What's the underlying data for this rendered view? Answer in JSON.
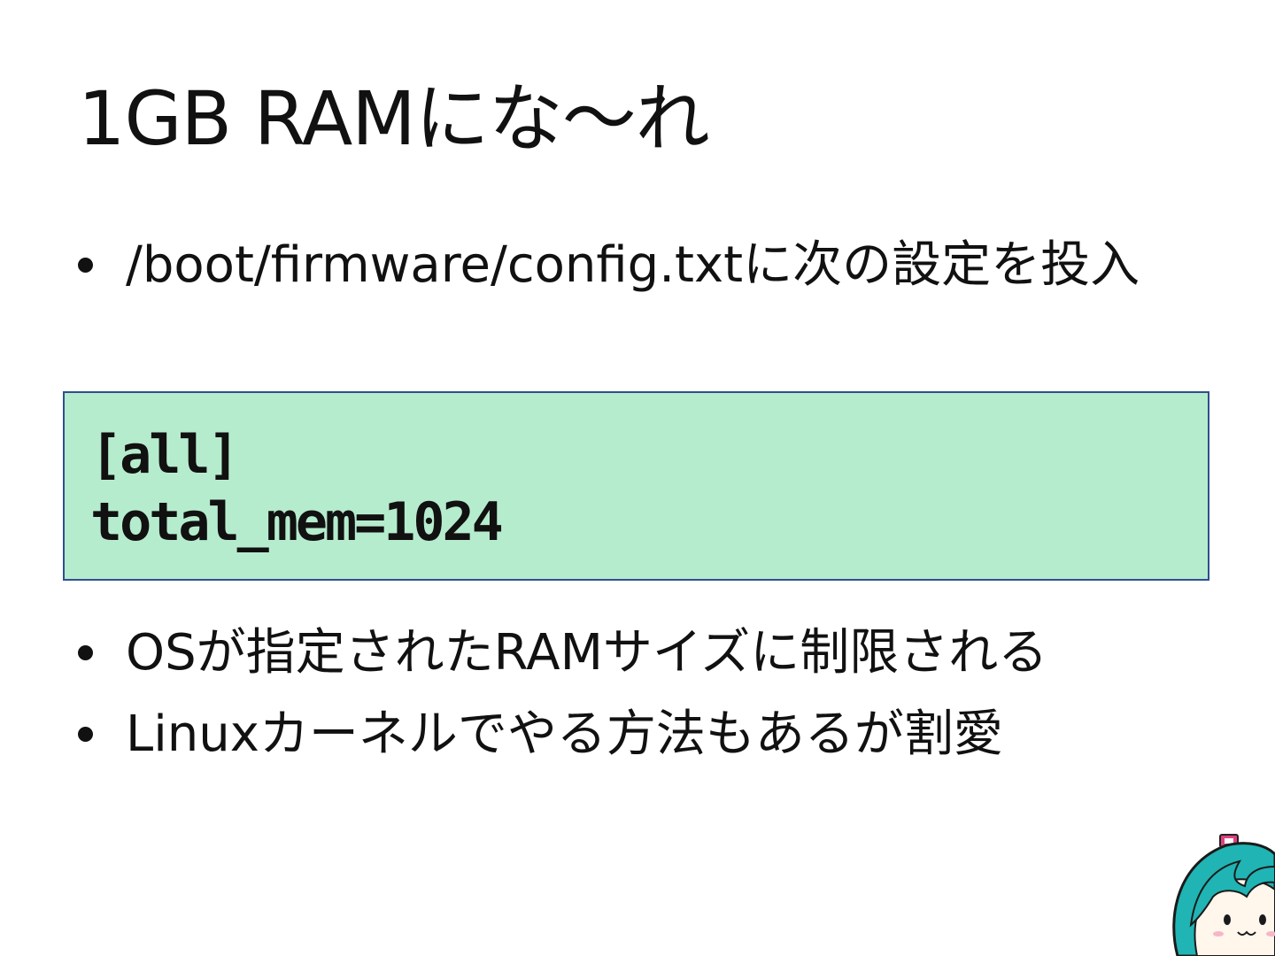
{
  "slide": {
    "title": "1GB RAMにな～れ",
    "bullets_top": [
      "/boot/firmware/config.txtに次の設定を投入"
    ],
    "code_block": {
      "lines": [
        "[all]",
        "total_mem=1024"
      ],
      "background_color": "#b6ecce",
      "border_color": "#2f4f8f"
    },
    "bullets_bottom": [
      "OSが指定されたRAMサイズに制限される",
      "Linuxカーネルでやる方法もあるが割愛"
    ],
    "mascot": {
      "icon": "teal-haired-character-icon",
      "hair_color": "#20b4b4",
      "ribbon_color": "#e0407f"
    }
  }
}
